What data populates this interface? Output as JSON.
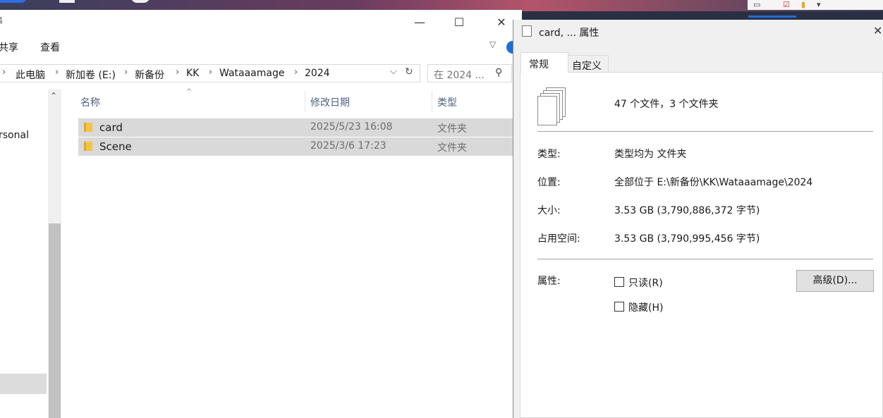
{
  "explorer": {
    "title_fragment": "4",
    "ribbon_tabs": [
      "共享",
      "查看"
    ],
    "breadcrumb": [
      "此电脑",
      "新加卷 (E:)",
      "新备份",
      "KK",
      "Wataaamage",
      "2024"
    ],
    "search_placeholder": "在 2024 ...",
    "nav_items": [
      "rsonal"
    ],
    "columns": {
      "name": "名称",
      "date": "修改日期",
      "type": "类型"
    },
    "rows": [
      {
        "name": "card",
        "date": "2025/5/23 16:08",
        "type": "文件夹"
      },
      {
        "name": "Scene",
        "date": "2025/3/6 17:23",
        "type": "文件夹"
      }
    ],
    "window_buttons": {
      "minimize": "—",
      "maximize": "☐",
      "close": "✕"
    }
  },
  "properties": {
    "title": "card, ... 属性",
    "tabs": [
      "常规",
      "自定义"
    ],
    "summary": "47 个文件，3 个文件夹",
    "fields": [
      {
        "label": "类型:",
        "value": "类型均为 文件夹"
      },
      {
        "label": "位置:",
        "value": "全部位于 E:\\新备份\\KK\\Wataaamage\\2024"
      },
      {
        "label": "大小:",
        "value": "3.53 GB (3,790,886,372 字节)"
      },
      {
        "label": "占用空间:",
        "value": "3.53 GB (3,790,995,456 字节)"
      }
    ],
    "attributes_label": "属性:",
    "readonly_label": "只读(R)",
    "hidden_label": "隐藏(H)",
    "advanced_button": "高级(D)...",
    "close": "✕"
  },
  "colors": {
    "selection": "#d9d9d9",
    "accent": "#1e6ed6",
    "folder": "#f2c54a"
  }
}
